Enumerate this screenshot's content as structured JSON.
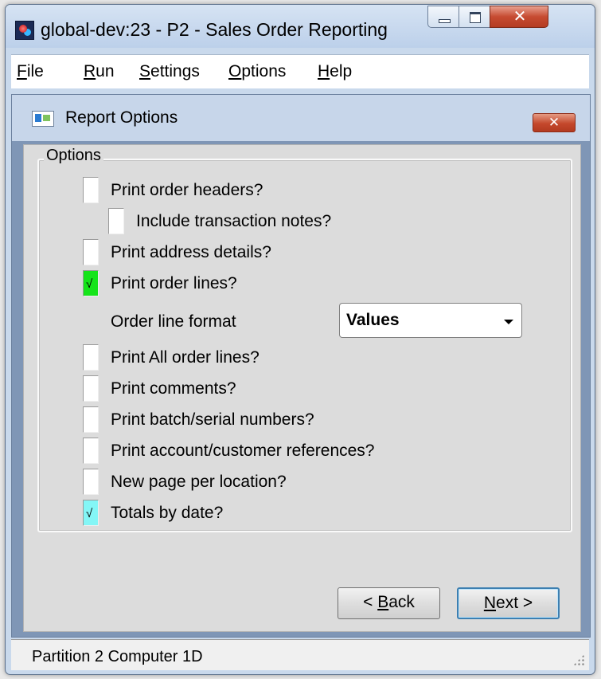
{
  "window": {
    "title": "global-dev:23 - P2 - Sales Order Reporting",
    "controls": {
      "minimize": "minimize",
      "maximize": "maximize",
      "close": "✕"
    }
  },
  "menu": {
    "items": [
      {
        "first": "F",
        "rest": "ile"
      },
      {
        "first": "R",
        "rest": "un"
      },
      {
        "first": "S",
        "rest": "ettings"
      },
      {
        "first": "O",
        "rest": "ptions"
      },
      {
        "first": "H",
        "rest": "elp"
      }
    ]
  },
  "panel": {
    "title": "Report Options",
    "close": "✕"
  },
  "options": {
    "legend": "Options",
    "items": [
      {
        "label": "Print order headers?",
        "checked": false,
        "color": "#ffffff"
      },
      {
        "label": "Include transaction notes?",
        "checked": false,
        "color": "#ffffff"
      },
      {
        "label": "Print address details?",
        "checked": false,
        "color": "#ffffff"
      },
      {
        "label": "Print order lines?",
        "checked": true,
        "color": "#16e41a",
        "tick": "√"
      },
      {
        "label": "Print All order lines?",
        "checked": false,
        "color": "#ffffff"
      },
      {
        "label": "Print comments?",
        "checked": false,
        "color": "#ffffff"
      },
      {
        "label": "Print batch/serial numbers?",
        "checked": false,
        "color": "#ffffff"
      },
      {
        "label": "Print account/customer references?",
        "checked": false,
        "color": "#ffffff"
      },
      {
        "label": "New page per location?",
        "checked": false,
        "color": "#ffffff"
      },
      {
        "label": "Totals by date?",
        "checked": true,
        "color": "#84f6f6",
        "tick": "√"
      }
    ],
    "order_line_format": {
      "label": "Order line format",
      "value": "Values"
    }
  },
  "buttons": {
    "back": {
      "prefix": "< ",
      "ul": "B",
      "rest": "ack"
    },
    "next": {
      "ul": "N",
      "rest": "ext >"
    }
  },
  "status": {
    "text": "Partition 2 Computer 1D"
  }
}
